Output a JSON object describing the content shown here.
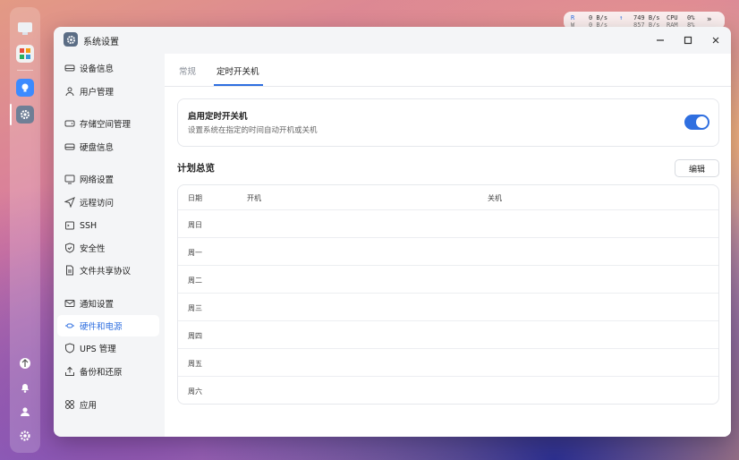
{
  "stats": {
    "r_label": "R",
    "r_rate": "0 B/s",
    "w_label": "W",
    "w_rate": "0 B/s",
    "up_rate": "749 B/s",
    "down_rate": "857 B/s",
    "cpu_label": "CPU",
    "cpu_value": "0%",
    "ram_label": "RAM",
    "ram_value": "8%"
  },
  "window": {
    "title": "系统设置"
  },
  "sidebar": {
    "groups": [
      [
        "设备信息",
        "用户管理"
      ],
      [
        "存储空间管理",
        "硬盘信息"
      ],
      [
        "网络设置",
        "远程访问",
        "SSH",
        "安全性",
        "文件共享协议"
      ],
      [
        "通知设置",
        "硬件和电源",
        "UPS 管理",
        "备份和还原"
      ],
      [
        "应用"
      ]
    ],
    "items": [
      {
        "label": "设备信息",
        "icon": "drive-icon"
      },
      {
        "label": "用户管理",
        "icon": "user-icon"
      },
      {
        "label": "存储空间管理",
        "icon": "storage-icon"
      },
      {
        "label": "硬盘信息",
        "icon": "disk-icon"
      },
      {
        "label": "网络设置",
        "icon": "monitor-icon"
      },
      {
        "label": "远程访问",
        "icon": "send-icon"
      },
      {
        "label": "SSH",
        "icon": "terminal-icon"
      },
      {
        "label": "安全性",
        "icon": "shield-check-icon"
      },
      {
        "label": "文件共享协议",
        "icon": "file-icon"
      },
      {
        "label": "通知设置",
        "icon": "mail-icon"
      },
      {
        "label": "硬件和电源",
        "icon": "power-plug-icon"
      },
      {
        "label": "UPS 管理",
        "icon": "shield-icon"
      },
      {
        "label": "备份和还原",
        "icon": "backup-icon"
      },
      {
        "label": "应用",
        "icon": "apps-icon"
      }
    ],
    "active": "硬件和电源"
  },
  "tabs": [
    {
      "label": "常规"
    },
    {
      "label": "定时开关机"
    }
  ],
  "schedule": {
    "enable_title": "启用定时开关机",
    "enable_desc": "设置系统在指定的时间自动开机或关机",
    "enabled": true,
    "plan_title": "计划总览",
    "edit_label": "编辑",
    "columns": [
      "日期",
      "开机",
      "关机"
    ],
    "rows": [
      "周日",
      "周一",
      "周二",
      "周三",
      "周四",
      "周五",
      "周六"
    ]
  },
  "colors": {
    "accent": "#2f6fe0",
    "window_bg": "#f4f5f7"
  }
}
